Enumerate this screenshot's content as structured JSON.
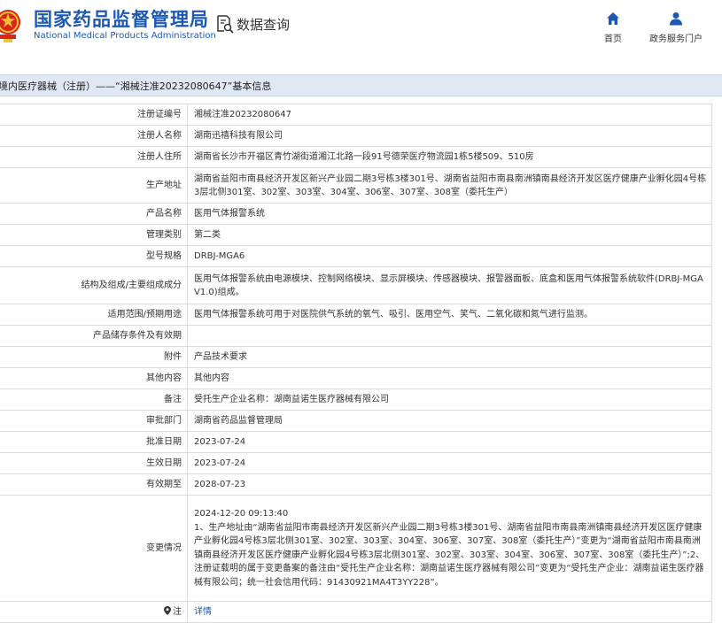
{
  "header": {
    "logo_cn": "国家药品监督管理局",
    "logo_en": "National Medical Products Administration",
    "query_label": "数据查询",
    "nav": [
      {
        "label": "首页",
        "icon": "home-icon"
      },
      {
        "label": "政务服务门户",
        "icon": "user-icon"
      }
    ]
  },
  "title": "境内医疗器械（注册）——“湘械注准20232080647”基本信息",
  "rows": [
    {
      "label": "注册证编号",
      "value": "湘械注准20232080647"
    },
    {
      "label": "注册人名称",
      "value": "湖南迅禧科技有限公司"
    },
    {
      "label": "注册人住所",
      "value": "湖南省长沙市开福区青竹湖街道湘江北路一段91号德荣医疗物流园1栋5楼509、510房"
    },
    {
      "label": "生产地址",
      "value": "湖南省益阳市南县经济开发区新兴产业园二期3号栋3楼301号、湖南省益阳市南县南洲镇南县经济开发区医疗健康产业孵化园4号栋3层北侧301室、302室、303室、304室、306室、307室、308室（委托生产）"
    },
    {
      "label": "产品名称",
      "value": "医用气体报警系统"
    },
    {
      "label": "管理类别",
      "value": "第二类"
    },
    {
      "label": "型号规格",
      "value": "DRBJ-MGA6"
    },
    {
      "label": "结构及组成/主要组成成分",
      "value": "医用气体报警系统由电源模块、控制网络模块、显示屏模块、传感器模块、报警器面板、底盒和医用气体报警系统软件(DRBJ-MGA V1.0)组成。"
    },
    {
      "label": "适用范围/预期用途",
      "value": "医用气体报警系统可用于对医院供气系统的氧气、吸引、医用空气、笑气、二氧化碳和氮气进行监测。"
    },
    {
      "label": "产品储存条件及有效期",
      "value": ""
    },
    {
      "label": "附件",
      "value": "产品技术要求"
    },
    {
      "label": "其他内容",
      "value": "其他内容"
    },
    {
      "label": "备注",
      "value": "受托生产企业名称：湖南益诺生医疗器械有限公司"
    },
    {
      "label": "审批部门",
      "value": "湖南省药品监督管理局"
    },
    {
      "label": "批准日期",
      "value": "2023-07-24"
    },
    {
      "label": "生效日期",
      "value": "2023-07-24"
    },
    {
      "label": "有效期至",
      "value": "2028-07-23"
    }
  ],
  "change": {
    "label": "变更情况",
    "date": "2024-12-20 09:13:40",
    "text": "1、生产地址由“湖南省益阳市南县经济开发区新兴产业园二期3号栋3楼301号、湖南省益阳市南县南洲镇南县经济开发区医疗健康产业孵化园4号栋3层北侧301室、302室、303室、304室、306室、307室、308室（委托生产）”变更为“湖南省益阳市南县南洲镇南县经济开发区医疗健康产业孵化园4号栋3层北侧301室、302室、303室、304室、306室、307室、308室（委托生产）”;2、注册证载明的属于变更备案的备注由“受托生产企业名称：湖南益诺生医疗器械有限公司”变更为“受托生产企业：湖南益诺生医疗器械有限公司；统一社会信用代码：91430921MA4T3YY228”。"
  },
  "note": {
    "label": "注",
    "link": "详情",
    "icon": "location-pin-icon"
  },
  "colors": {
    "brand": "#1d59b3",
    "titlebar_bg": "#dfe8f3",
    "border": "#dadada"
  }
}
